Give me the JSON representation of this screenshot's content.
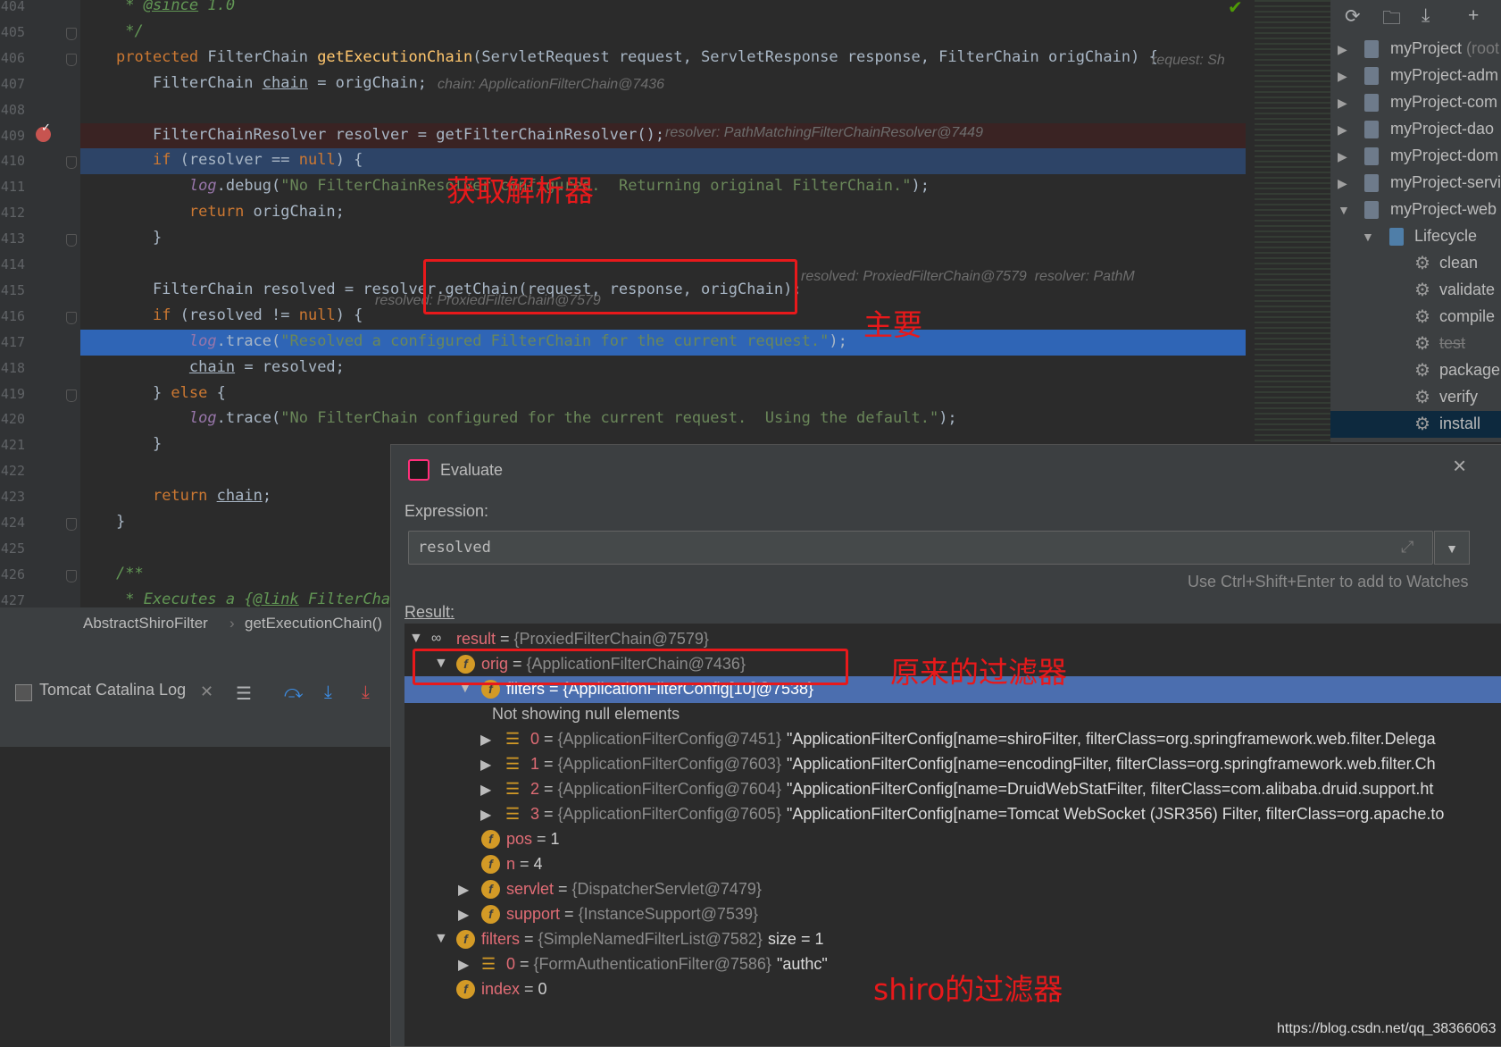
{
  "editor": {
    "lines": [
      {
        "n": "404",
        "html": "<span class='cmt'> * <u>@since</u> 1.0</span>"
      },
      {
        "n": "405",
        "html": "<span class='cmt'> */</span>"
      },
      {
        "n": "406",
        "html": "<span class='kw'>protected</span> FilterChain <span class='fn'>getExecutionChain</span>(ServletRequest request, ServletResponse response, FilterChain origChain) {"
      },
      {
        "n": "407",
        "html": "    FilterChain <span class='var-u'>chain</span> = origChain;"
      },
      {
        "n": "408",
        "html": ""
      },
      {
        "n": "409",
        "html": "    FilterChainResolver resolver = getFilterChainResolver();"
      },
      {
        "n": "410",
        "html": "    <span class='kw'>if</span> (resolver == <span class='kw'>null</span>) {"
      },
      {
        "n": "411",
        "html": "        <span class='log'>log</span>.debug(<span class='str'>\"No FilterChainResolver configured.  Returning original FilterChain.\"</span>);"
      },
      {
        "n": "412",
        "html": "        <span class='kw'>return</span> origChain;"
      },
      {
        "n": "413",
        "html": "    }"
      },
      {
        "n": "414",
        "html": ""
      },
      {
        "n": "415",
        "html": "    FilterChain resolved = resolver.getChain(request, response, origChain);"
      },
      {
        "n": "416",
        "html": "    <span class='kw'>if</span> (resolved != <span class='kw'>null</span>) {"
      },
      {
        "n": "417",
        "html": "        <span class='log'>log</span>.trace(<span class='str'>\"Resolved a configured FilterChain for the current request.\"</span>);"
      },
      {
        "n": "418",
        "html": "        <span class='var-u'>chain</span> = resolved;"
      },
      {
        "n": "419",
        "html": "    } <span class='kw'>else</span> {"
      },
      {
        "n": "420",
        "html": "        <span class='log'>log</span>.trace(<span class='str'>\"No FilterChain configured for the current request.  Using the default.\"</span>);"
      },
      {
        "n": "421",
        "html": "    }"
      },
      {
        "n": "422",
        "html": ""
      },
      {
        "n": "423",
        "html": "    <span class='kw'>return</span> <span class='var-u'>chain</span>;"
      },
      {
        "n": "424",
        "html": "}"
      },
      {
        "n": "425",
        "html": ""
      },
      {
        "n": "426",
        "html": "<span class='cmt'>/**</span>"
      },
      {
        "n": "427",
        "html": "<span class='cmt'> * Executes a {<u>@link</u> FilterChain</span>"
      }
    ],
    "hints": {
      "h406": "request: Sh",
      "h407": "chain: ApplicationFilterChain@7436",
      "h409": "resolver: PathMatchingFilterChainResolver@7449",
      "h415": "resolved: ProxiedFilterChain@7579  resolver: PathM",
      "h416": "resolved: ProxiedFilterChain@7579"
    }
  },
  "annotations": {
    "get_resolver": "获取解析器",
    "main": "主要",
    "original_filters": "原来的过滤器",
    "shiro_filters": "shiro的过滤器"
  },
  "breadcrumb": {
    "class": "AbstractShiroFilter",
    "method": "getExecutionChain()"
  },
  "run_panel": {
    "tab_label": "Tomcat Catalina Log"
  },
  "project": {
    "modules": [
      "myProject (root",
      "myProject-adm",
      "myProject-com",
      "myProject-dao",
      "myProject-dom",
      "myProject-servi",
      "myProject-web"
    ],
    "lifecycle_label": "Lifecycle",
    "phases": [
      "clean",
      "validate",
      "compile",
      "test",
      "package",
      "verify",
      "install"
    ]
  },
  "dialog": {
    "title": "Evaluate",
    "expression_label": "Expression:",
    "expression_value": "resolved",
    "hint": "Use Ctrl+Shift+Enter to add to Watches",
    "result_label": "Result:"
  },
  "result_tree": [
    {
      "name": "result",
      "type": "{ProxiedFilterChain@7579}",
      "value": ""
    },
    {
      "name": "orig",
      "type": "{ApplicationFilterChain@7436}",
      "value": ""
    },
    {
      "name": "filters",
      "type": "{ApplicationFilterConfig[10]@7538}",
      "value": ""
    },
    {
      "name": "Not showing null elements",
      "type": "",
      "value": ""
    },
    {
      "name": "0",
      "type": "{ApplicationFilterConfig@7451}",
      "value": "\"ApplicationFilterConfig[name=shiroFilter, filterClass=org.springframework.web.filter.Delega"
    },
    {
      "name": "1",
      "type": "{ApplicationFilterConfig@7603}",
      "value": "\"ApplicationFilterConfig[name=encodingFilter, filterClass=org.springframework.web.filter.Ch"
    },
    {
      "name": "2",
      "type": "{ApplicationFilterConfig@7604}",
      "value": "\"ApplicationFilterConfig[name=DruidWebStatFilter, filterClass=com.alibaba.druid.support.ht"
    },
    {
      "name": "3",
      "type": "{ApplicationFilterConfig@7605}",
      "value": "\"ApplicationFilterConfig[name=Tomcat WebSocket (JSR356) Filter, filterClass=org.apache.to"
    },
    {
      "name": "pos",
      "type": "",
      "value": "1"
    },
    {
      "name": "n",
      "type": "",
      "value": "4"
    },
    {
      "name": "servlet",
      "type": "{DispatcherServlet@7479}",
      "value": ""
    },
    {
      "name": "support",
      "type": "{InstanceSupport@7539}",
      "value": ""
    },
    {
      "name": "filters",
      "type": "{SimpleNamedFilterList@7582}",
      "value": "size = 1"
    },
    {
      "name": "0",
      "type": "{FormAuthenticationFilter@7586}",
      "value": "\"authc\""
    },
    {
      "name": "index",
      "type": "",
      "value": "0"
    }
  ],
  "watermark": "https://blog.csdn.net/qq_38366063"
}
